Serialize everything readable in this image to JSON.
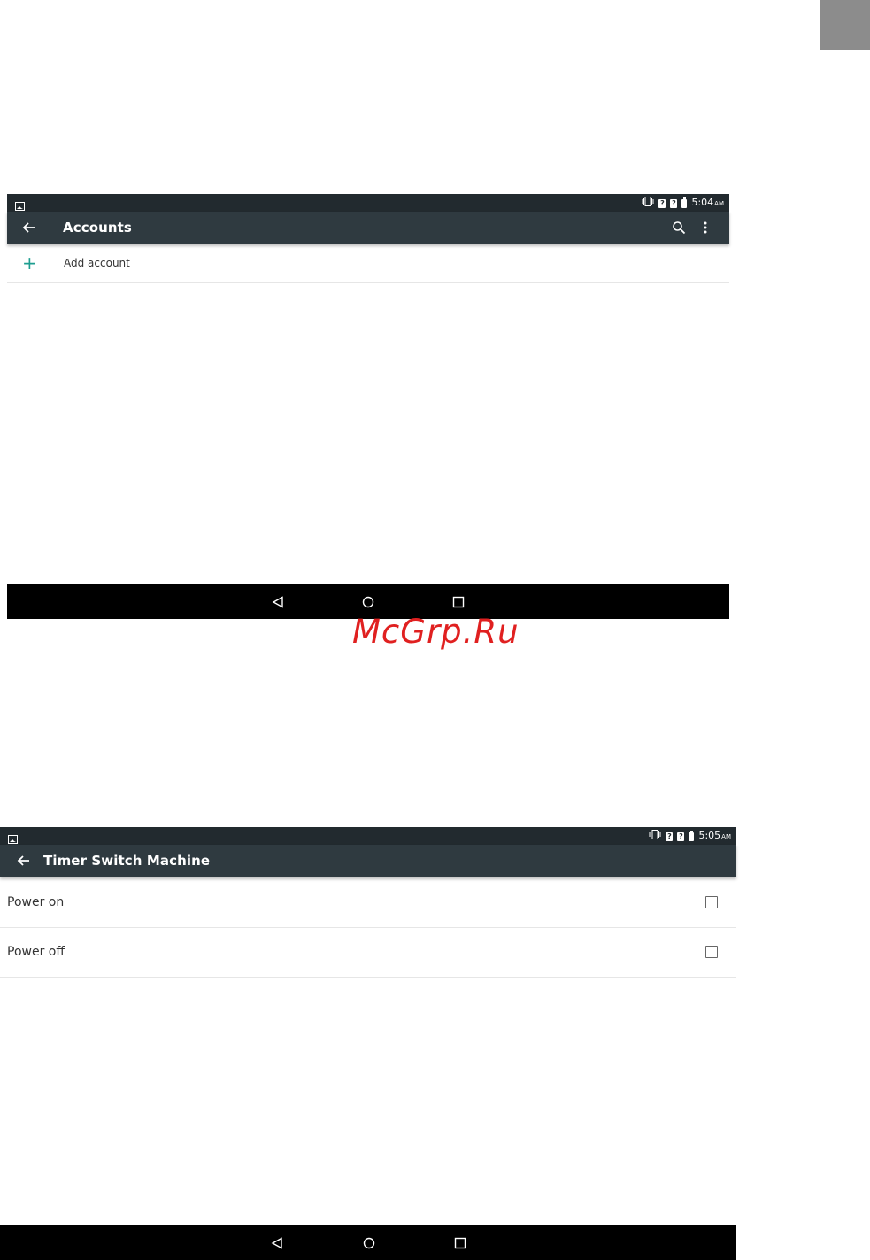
{
  "watermark": "McGrp.Ru",
  "screen1": {
    "status": {
      "time": "5:04",
      "ampm": "AM",
      "sim1": "?",
      "sim2": "?"
    },
    "toolbar": {
      "title": "Accounts",
      "icons": [
        "back-arrow-icon",
        "search-icon",
        "more-vert-icon"
      ]
    },
    "add_account": {
      "label": "Add account",
      "accent": "#1e9e90"
    },
    "navbar": {
      "icons": [
        "nav-back-icon",
        "nav-home-icon",
        "nav-recents-icon"
      ]
    }
  },
  "screen2": {
    "status": {
      "time": "5:05",
      "ampm": "AM",
      "sim1": "?",
      "sim2": "?"
    },
    "toolbar": {
      "title": "Timer Switch Machine",
      "icons": [
        "back-arrow-icon"
      ]
    },
    "items": [
      {
        "label": "Power on",
        "checked": false
      },
      {
        "label": "Power off",
        "checked": false
      }
    ],
    "navbar": {
      "icons": [
        "nav-back-icon",
        "nav-home-icon",
        "nav-recents-icon"
      ]
    }
  },
  "colors": {
    "status_bar": "#222a2f",
    "toolbar": "#2f3a40",
    "nav_bar": "#000000"
  }
}
